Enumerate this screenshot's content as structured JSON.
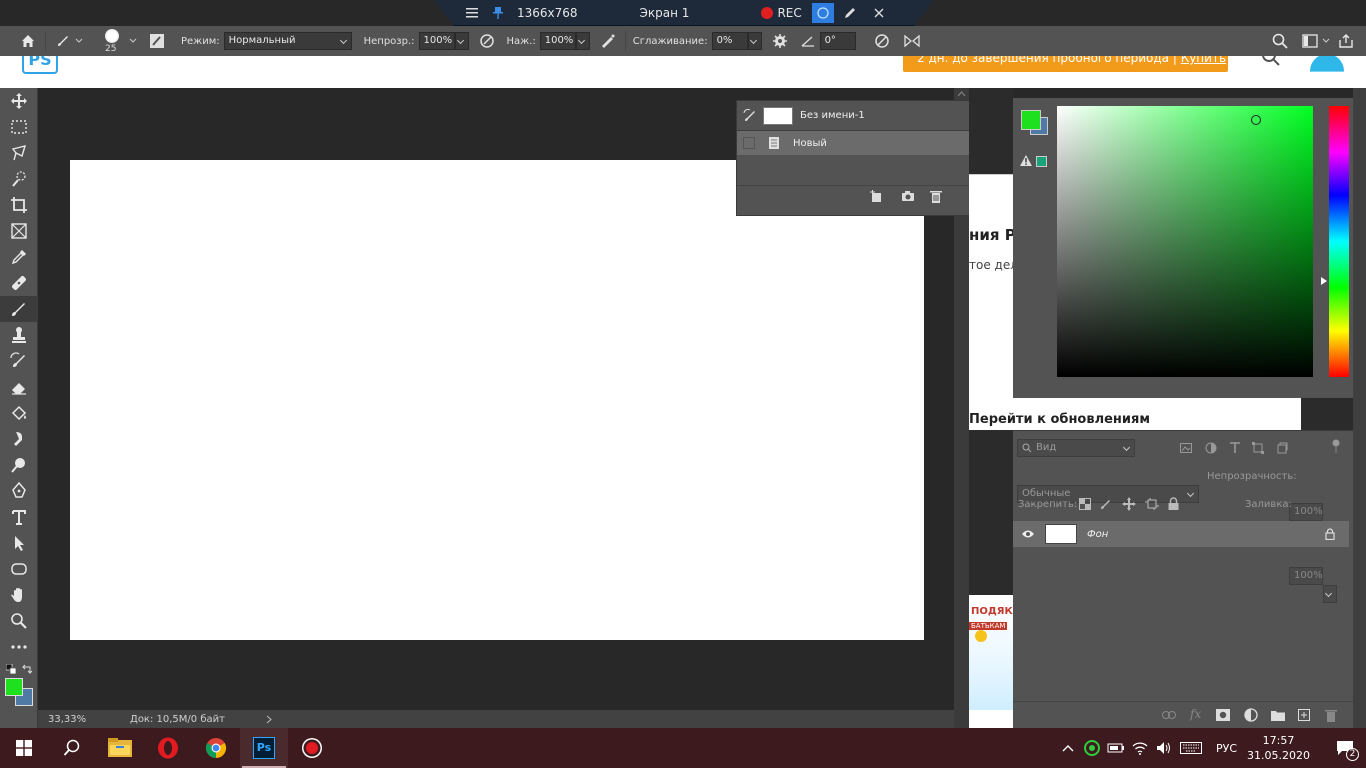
{
  "recorder": {
    "resolution": "1366x768",
    "screen": "Экран 1",
    "rec_label": "REC"
  },
  "options": {
    "brush_size": "25",
    "mode_label": "Режим:",
    "mode_value": "Нормальный",
    "opacity_label": "Непрозр.:",
    "opacity_value": "100%",
    "pressure_label": "Наж.:",
    "pressure_value": "100%",
    "smoothing_label": "Сглаживание:",
    "smoothing_value": "0%",
    "angle_value": "0°"
  },
  "web_bg": {
    "logo": "PS",
    "trial_text": "2 дн. до завершения пробного периода",
    "buy_label": "Купить",
    "heading_fragment": "ния Р",
    "text_fragment": "тое дел",
    "updates_link": "Перейти к обновлениям",
    "banner_text_1": "ПОДЯКА",
    "banner_text_2": "БАТЬКАМ"
  },
  "history": {
    "snapshot_name": "Без имени-1",
    "step_name": "Новый"
  },
  "color": {
    "foreground": "#1ee01e",
    "background": "#4f7aa6",
    "websafe": "#19a37a",
    "hue": "#00ff22"
  },
  "layers": {
    "filter_placeholder": "Вид",
    "blend_mode": "Обычные",
    "opacity_label": "Непрозрачность:",
    "opacity_value": "100%",
    "lock_label": "Закрепить:",
    "fill_label": "Заливка:",
    "fill_value": "100%",
    "items": [
      {
        "name": "Фон"
      }
    ]
  },
  "status": {
    "zoom": "33,33%",
    "doc_info": "Док: 10,5M/0 байт"
  },
  "taskbar": {
    "lang": "РУС",
    "time": "17:57",
    "date": "31.05.2020",
    "notifications": "2"
  }
}
